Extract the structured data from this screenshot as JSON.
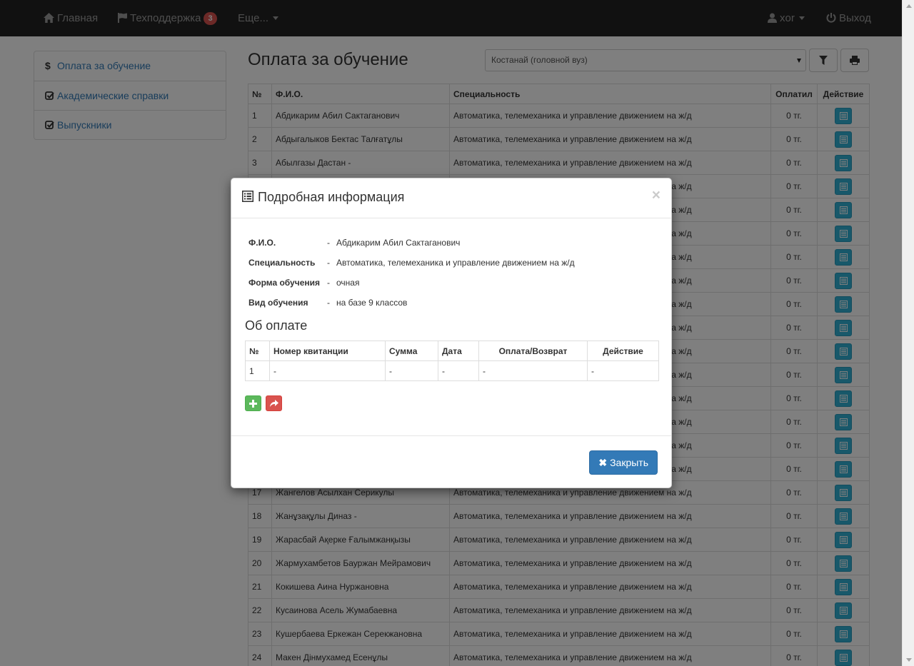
{
  "navbar": {
    "home": "Главная",
    "support": "Техподдержка",
    "support_badge": "3",
    "more": "Еще...",
    "user": "xor",
    "logout": "Выход"
  },
  "sidebar": {
    "items": [
      {
        "label": "Оплата за обучение",
        "icon": "dollar-icon"
      },
      {
        "label": "Академические справки",
        "icon": "check-square-icon"
      },
      {
        "label": "Выпускники",
        "icon": "check-square-icon"
      }
    ]
  },
  "header": {
    "title": "Оплата за обучение",
    "branch_select": "Костанай (головной вуз)"
  },
  "table": {
    "columns": [
      "№",
      "Ф.И.О.",
      "Специальность",
      "Оплатил",
      "Действие"
    ],
    "rows": [
      {
        "n": "1",
        "name": "Абдикарим Абил Сактаганович",
        "spec": "Автоматика, телемеханика и управление движением на ж/д",
        "paid": "0 тг."
      },
      {
        "n": "2",
        "name": "Абдыгалыков Бектас Талғатұлы",
        "spec": "Автоматика, телемеханика и управление движением на ж/д",
        "paid": "0 тг."
      },
      {
        "n": "3",
        "name": "Абылгазы Дастан -",
        "spec": "Автоматика, телемеханика и управление движением на ж/д",
        "paid": "0 тг."
      },
      {
        "n": "",
        "name": "",
        "spec": "Автоматика, телемеханика и управление движением на ж/д",
        "paid": "0 тг."
      },
      {
        "n": "",
        "name": "",
        "spec": "Автоматика, телемеханика и управление движением на ж/д",
        "paid": "0 тг."
      },
      {
        "n": "",
        "name": "",
        "spec": "Автоматика, телемеханика и управление движением на ж/д",
        "paid": "0 тг."
      },
      {
        "n": "",
        "name": "",
        "spec": "Автоматика, телемеханика и управление движением на ж/д",
        "paid": "0 тг."
      },
      {
        "n": "",
        "name": "",
        "spec": "Автоматика, телемеханика и управление движением на ж/д",
        "paid": "0 тг."
      },
      {
        "n": "",
        "name": "",
        "spec": "Автоматика, телемеханика и управление движением на ж/д",
        "paid": "0 тг."
      },
      {
        "n": "",
        "name": "",
        "spec": "Автоматика, телемеханика и управление движением на ж/д",
        "paid": "0 тг."
      },
      {
        "n": "",
        "name": "",
        "spec": "Автоматика, телемеханика и управление движением на ж/д",
        "paid": "0 тг."
      },
      {
        "n": "",
        "name": "",
        "spec": "Автоматика, телемеханика и управление движением на ж/д",
        "paid": "0 тг."
      },
      {
        "n": "",
        "name": "",
        "spec": "Автоматика, телемеханика и управление движением на ж/д",
        "paid": "0 тг."
      },
      {
        "n": "",
        "name": "",
        "spec": "Автоматика, телемеханика и управление движением на ж/д",
        "paid": "0 тг."
      },
      {
        "n": "",
        "name": "",
        "spec": "Автоматика, телемеханика и управление движением на ж/д",
        "paid": "0 тг."
      },
      {
        "n": "",
        "name": "",
        "spec": "Автоматика, телемеханика и управление движением на ж/д",
        "paid": "0 тг."
      },
      {
        "n": "17",
        "name": "Жангелов Асылхан Серикулы",
        "spec": "Автоматика, телемеханика и управление движением на ж/д",
        "paid": "0 тг."
      },
      {
        "n": "18",
        "name": "Жанұзақұлы Диназ -",
        "spec": "Автоматика, телемеханика и управление движением на ж/д",
        "paid": "0 тг."
      },
      {
        "n": "19",
        "name": "Жарасбай Ақерке Ғалымжанқызы",
        "spec": "Автоматика, телемеханика и управление движением на ж/д",
        "paid": "0 тг."
      },
      {
        "n": "20",
        "name": "Жармухамбетов Бауржан Мейрамович",
        "spec": "Автоматика, телемеханика и управление движением на ж/д",
        "paid": "0 тг."
      },
      {
        "n": "21",
        "name": "Кокишева Аина Нуржановна",
        "spec": "Автоматика, телемеханика и управление движением на ж/д",
        "paid": "0 тг."
      },
      {
        "n": "22",
        "name": "Кусаинова Асель Жумабаевна",
        "spec": "Автоматика, телемеханика и управление движением на ж/д",
        "paid": "0 тг."
      },
      {
        "n": "23",
        "name": "Кушербаева Еркежан Серекжановна",
        "spec": "Автоматика, телемеханика и управление движением на ж/д",
        "paid": "0 тг."
      },
      {
        "n": "24",
        "name": "Макен Дінмухамед Есенұлы",
        "spec": "Автоматика, телемеханика и управление движением на ж/д",
        "paid": "0 тг."
      }
    ]
  },
  "modal": {
    "title": "Подробная информация",
    "close_symbol": "×",
    "fields": [
      {
        "label": "Ф.И.О.",
        "dash": "-",
        "value": "Абдикарим Абил Сактаганович"
      },
      {
        "label": "Специальность",
        "dash": "-",
        "value": "Автоматика, телемеханика и управление движением на ж/д"
      },
      {
        "label": "Форма обучения",
        "dash": "-",
        "value": "очная"
      },
      {
        "label": "Вид обучения",
        "dash": "-",
        "value": "на базе 9 классов"
      }
    ],
    "payment_title": "Об оплате",
    "payment_columns": [
      "№",
      "Номер квитанции",
      "Сумма",
      "Дата",
      "Оплата/Возврат",
      "Действие"
    ],
    "payment_rows": [
      {
        "n": "1",
        "receipt": "-",
        "sum": "-",
        "date": "-",
        "type": "-",
        "action": "-"
      }
    ],
    "close_button": "Закрыть",
    "close_button_symbol": "✖"
  }
}
